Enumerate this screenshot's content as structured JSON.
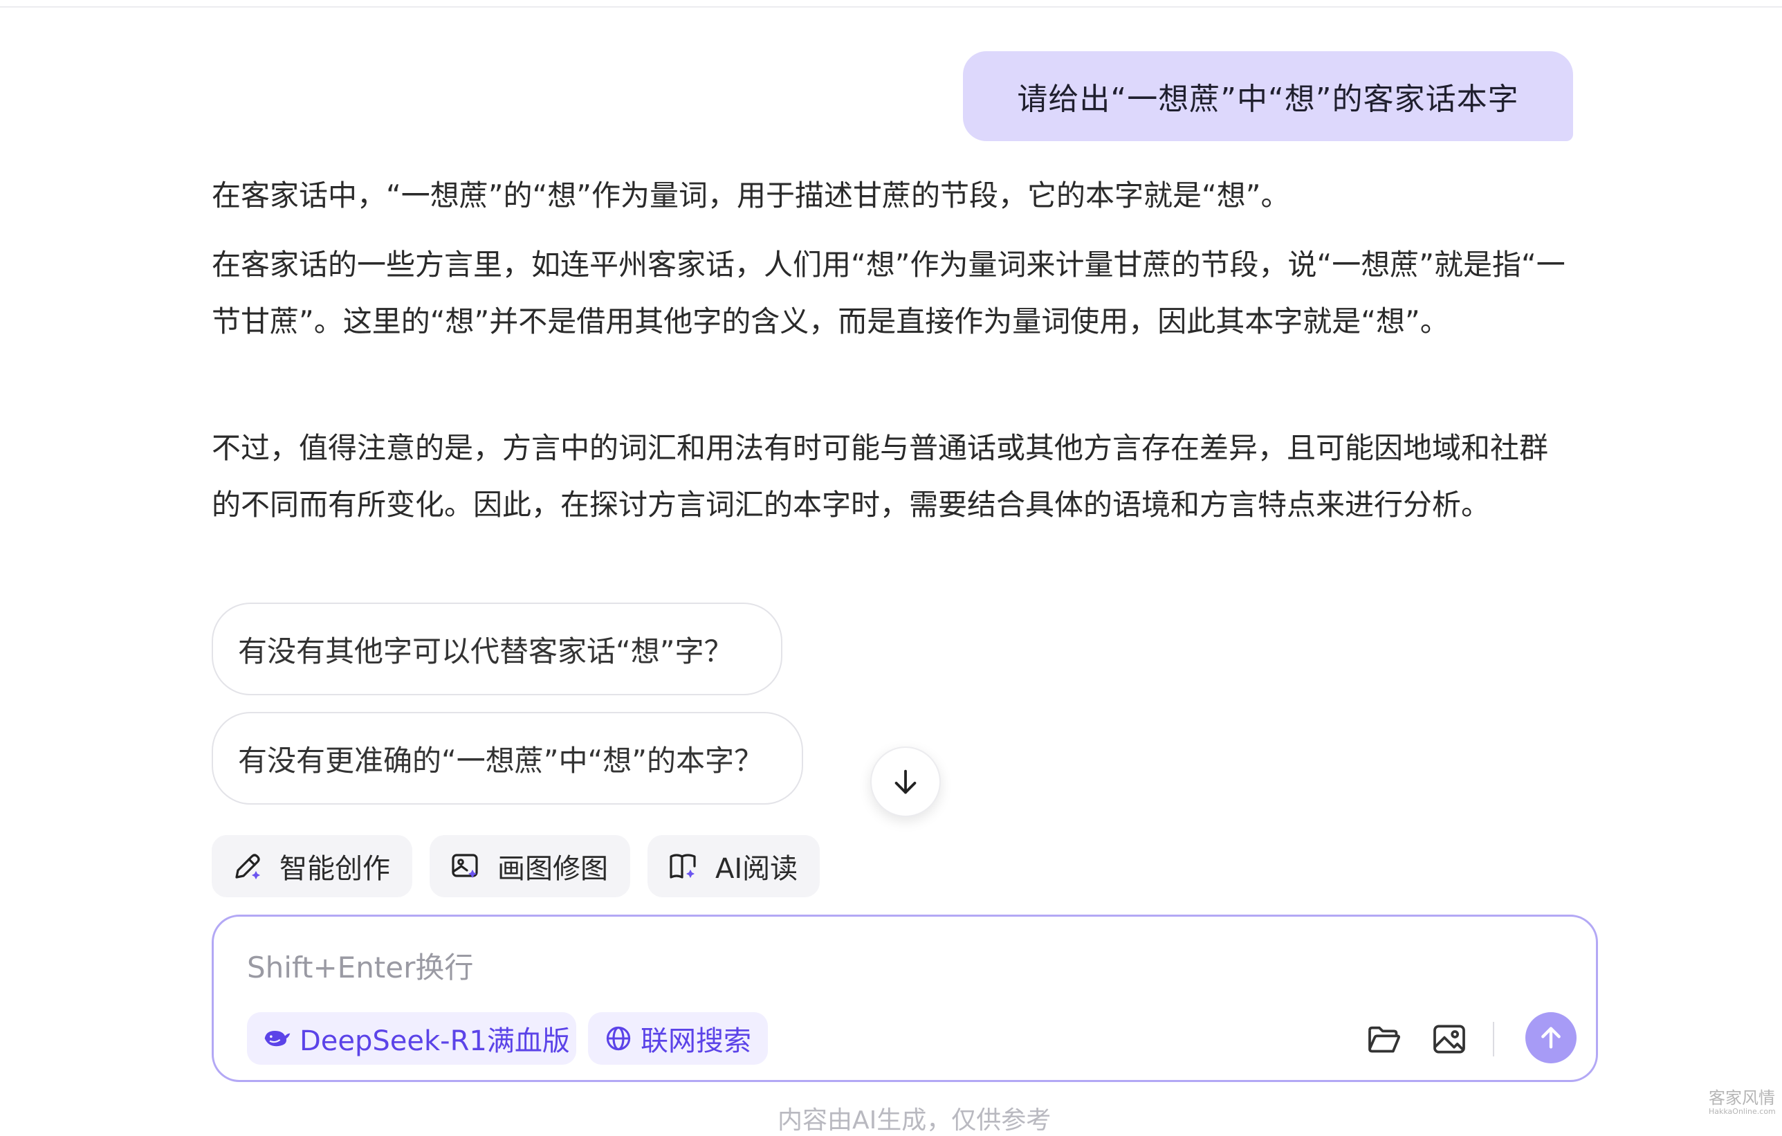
{
  "conversation": {
    "user_message": "请给出“一想蔗”中“想”的客家话本字",
    "answer_paragraphs": [
      "在客家话中，“一想蔗”的“想”作为量词，用于描述甘蔗的节段，它的本字就是“想”。",
      "在客家话的一些方言里，如连平州客家话，人们用“想”作为量词来计量甘蔗的节段，说“一想蔗”就是指“一节甘蔗”。这里的“想”并不是借用其他字的含义，而是直接作为量词使用，因此其本字就是“想”。",
      "不过，值得注意的是，方言中的词汇和用法有时可能与普通话或其他方言存在差异，且可能因地域和社群的不同而有所变化。因此，在探讨方言词汇的本字时，需要结合具体的语境和方言特点来进行分析。"
    ],
    "suggestions": [
      "有没有其他字可以代替客家话“想”字？",
      "有没有更准确的“一想蔗”中“想”的本字？"
    ]
  },
  "tools": {
    "smart_create": "智能创作",
    "image_edit": "画图修图",
    "ai_read": "AI阅读"
  },
  "composer": {
    "placeholder": "Shift+Enter换行",
    "model_chip": "DeepSeek-R1满血版",
    "web_search_chip": "联网搜索"
  },
  "footer": {
    "disclaimer": "内容由AI生成，仅供参考"
  },
  "watermark": {
    "main": "客家风情",
    "sub": "HakkaOnline.com"
  },
  "colors": {
    "user_bubble": "#ddd8fc",
    "accent": "#5b43e8",
    "composer_border": "#b3a8f5",
    "send_button": "#a79bf6"
  }
}
